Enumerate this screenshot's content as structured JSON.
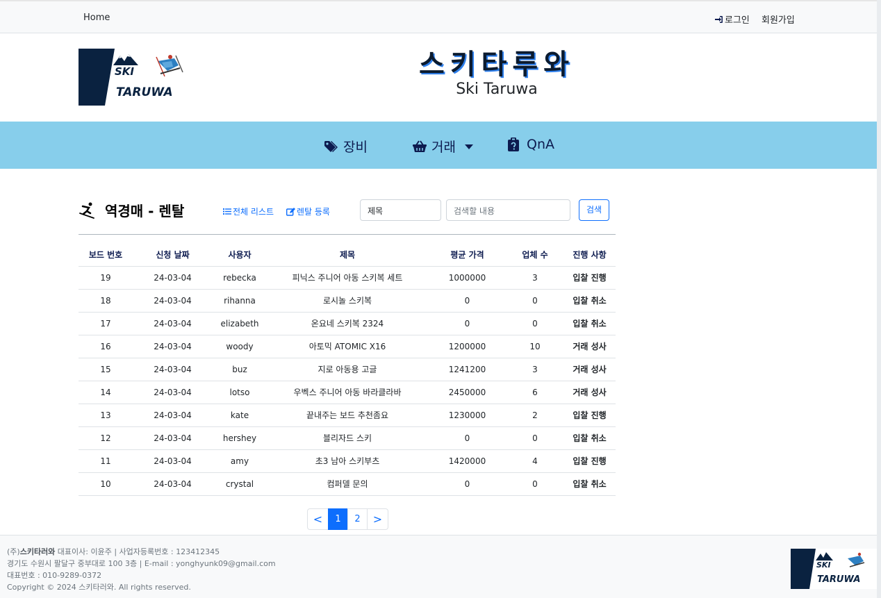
{
  "topbar": {
    "home_label": "Home",
    "login_label": "로그인",
    "signup_label": "회원가입"
  },
  "header": {
    "logo_line1": "SKI",
    "logo_line2": "TARUWA",
    "title": "스키타루와",
    "subtitle": "Ski Taruwa"
  },
  "nav": {
    "items": [
      {
        "label": "장비",
        "icon": "tags-icon"
      },
      {
        "label": "거래",
        "icon": "basket-icon"
      },
      {
        "label": "QnA",
        "icon": "clipboard-question-icon"
      }
    ]
  },
  "board": {
    "title": "역경매 - 렌탈",
    "list_link": "전체 리스트",
    "register_link": "렌탈 등록",
    "search_field": "제목",
    "search_placeholder": "검색할 내용",
    "search_button": "검색",
    "columns": [
      "보드 번호",
      "신청 날짜",
      "사용자",
      "제목",
      "평균 가격",
      "업체 수",
      "진행 사항"
    ],
    "rows": [
      {
        "no": "19",
        "date": "24-03-04",
        "user": "rebecka",
        "title": "피닉스 주니어 아동 스키복 세트",
        "price": "1000000",
        "count": "3",
        "status": "입찰 진행",
        "status_type": "ongoing"
      },
      {
        "no": "18",
        "date": "24-03-04",
        "user": "rihanna",
        "title": "로시놀 스키복",
        "price": "0",
        "count": "0",
        "status": "입찰 취소",
        "status_type": "cancel"
      },
      {
        "no": "17",
        "date": "24-03-04",
        "user": "elizabeth",
        "title": "온요네 스키복 2324",
        "price": "0",
        "count": "0",
        "status": "입찰 취소",
        "status_type": "cancel"
      },
      {
        "no": "16",
        "date": "24-03-04",
        "user": "woody",
        "title": "아토믹 ATOMIC X16",
        "price": "1200000",
        "count": "10",
        "status": "거래 성사",
        "status_type": "deal"
      },
      {
        "no": "15",
        "date": "24-03-04",
        "user": "buz",
        "title": "지로 아동용 고글",
        "price": "1241200",
        "count": "3",
        "status": "거래 성사",
        "status_type": "deal"
      },
      {
        "no": "14",
        "date": "24-03-04",
        "user": "lotso",
        "title": "우벡스 주니어 아동 바라클라바",
        "price": "2450000",
        "count": "6",
        "status": "거래 성사",
        "status_type": "deal"
      },
      {
        "no": "13",
        "date": "24-03-04",
        "user": "kate",
        "title": "끝내주는 보드 추천좀요",
        "price": "1230000",
        "count": "2",
        "status": "입찰 진행",
        "status_type": "ongoing"
      },
      {
        "no": "12",
        "date": "24-03-04",
        "user": "hershey",
        "title": "블리자드 스키",
        "price": "0",
        "count": "0",
        "status": "입찰 취소",
        "status_type": "cancel"
      },
      {
        "no": "11",
        "date": "24-03-04",
        "user": "amy",
        "title": "초3 남아 스키부츠",
        "price": "1420000",
        "count": "4",
        "status": "입찰 진행",
        "status_type": "ongoing"
      },
      {
        "no": "10",
        "date": "24-03-04",
        "user": "crystal",
        "title": "컴퍼델 문의",
        "price": "0",
        "count": "0",
        "status": "입찰 취소",
        "status_type": "cancel"
      }
    ]
  },
  "pagination": {
    "prev": "<",
    "pages": [
      "1",
      "2"
    ],
    "current": "1",
    "next": ">"
  },
  "footer": {
    "company_prefix": "(주)",
    "company_name": "스키타러와",
    "line1_rest": " 대표이사: 이윤주 | 사업자등록번호 : 123412345",
    "line2": "경기도 수원시 팔달구 중부대로 100 3층 | E-mail : yonghyunk09@gmail.com",
    "line3": "대표번호 : 010-9289-0372",
    "line4": "Copyright © 2024 스키타러와. All rights reserved."
  },
  "colors": {
    "nav_bg": "#87ceeb",
    "link_blue": "#0d6efd",
    "title_shadow": "#2f80ed",
    "status_deal": "#6f2a8a",
    "status_cancel": "#6c757d",
    "logo_navy": "#0a2240"
  }
}
